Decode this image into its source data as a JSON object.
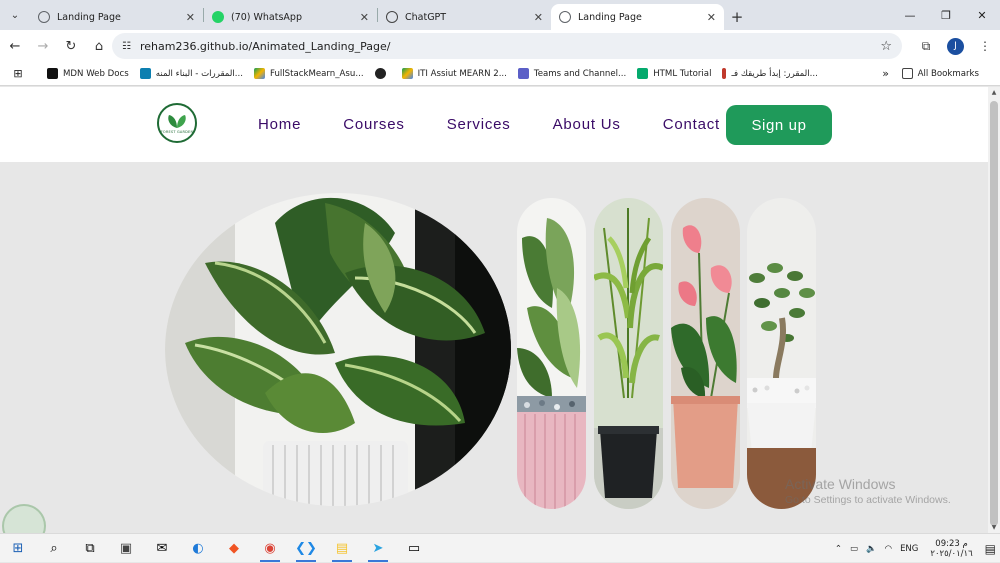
{
  "browser": {
    "tabs": [
      {
        "title": "Landing Page",
        "active": false,
        "favicon_color": "#5f6368"
      },
      {
        "title": "(70) WhatsApp",
        "active": false,
        "favicon_color": "#25d366"
      },
      {
        "title": "ChatGPT",
        "active": false,
        "favicon_color": "#444444"
      },
      {
        "title": "Landing Page",
        "active": true,
        "favicon_color": "#5f6368"
      }
    ],
    "url": "reham236.github.io/Animated_Landing_Page/",
    "profile_initial": "J"
  },
  "bookmarks": {
    "items": [
      {
        "label": "MDN Web Docs",
        "icon": "mdn-icon",
        "color": "#111111"
      },
      {
        "label": "المقررات - البناء المنه...",
        "icon": "courses-icon",
        "color": "#0c7fb0"
      },
      {
        "label": "FullStackMearn_Asu...",
        "icon": "google-drive-icon",
        "color": "#f4b400"
      },
      {
        "label": "",
        "icon": "github-icon",
        "color": "#222222"
      },
      {
        "label": "ITI Assiut MEARN 2...",
        "icon": "google-drive-icon",
        "color": "#0f9d58"
      },
      {
        "label": "Teams and Channel...",
        "icon": "teams-icon",
        "color": "#5b5fc7"
      },
      {
        "label": "HTML Tutorial",
        "icon": "w3schools-icon",
        "color": "#04aa6d"
      },
      {
        "label": "المقرر: إبدأ طريقك فـ...",
        "icon": "course-icon",
        "color": "#c0392b"
      }
    ],
    "all_bookmarks": "All Bookmarks"
  },
  "site": {
    "logo_text": "FOREST GARDEN",
    "nav": [
      "Home",
      "Courses",
      "Services",
      "About Us",
      "Contact Us"
    ],
    "signup_label": "Sign up",
    "accent_color": "#1f9a5a",
    "nav_text_color": "#3a0b67"
  },
  "overlay": {
    "activate_title": "Activate Windows",
    "activate_sub": "Go to Settings to activate Windows."
  },
  "taskbar": {
    "language": "ENG",
    "time": "09:23 م",
    "date": "٢٠٢٥/٠١/١٦"
  }
}
